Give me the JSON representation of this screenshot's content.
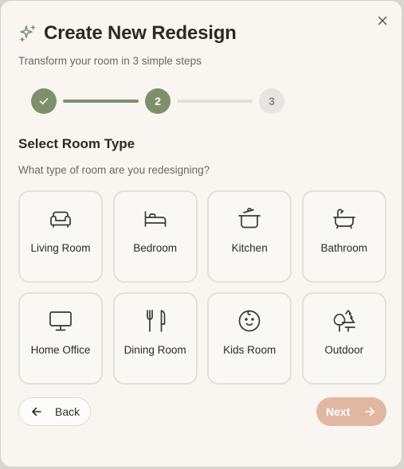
{
  "dialog": {
    "title": "Create New Redesign",
    "subtitle": "Transform your room in 3 simple steps"
  },
  "stepper": {
    "steps": [
      {
        "label": "",
        "state": "complete"
      },
      {
        "label": "2",
        "state": "active"
      },
      {
        "label": "3",
        "state": "upcoming"
      }
    ]
  },
  "section": {
    "title": "Select Room Type",
    "question": "What type of room are you redesigning?"
  },
  "rooms": [
    {
      "label": "Living Room",
      "icon": "sofa-icon"
    },
    {
      "label": "Bedroom",
      "icon": "bed-icon"
    },
    {
      "label": "Kitchen",
      "icon": "cooking-pot-icon"
    },
    {
      "label": "Bathroom",
      "icon": "bathtub-icon"
    },
    {
      "label": "Home Office",
      "icon": "monitor-icon"
    },
    {
      "label": "Dining Room",
      "icon": "utensils-icon"
    },
    {
      "label": "Kids Room",
      "icon": "baby-face-icon"
    },
    {
      "label": "Outdoor",
      "icon": "trees-icon"
    }
  ],
  "actions": {
    "back_label": "Back",
    "next_label": "Next"
  },
  "colors": {
    "accent": "#7e8f6c",
    "next_button": "#e2b7a1",
    "background": "#f9f6f1"
  }
}
